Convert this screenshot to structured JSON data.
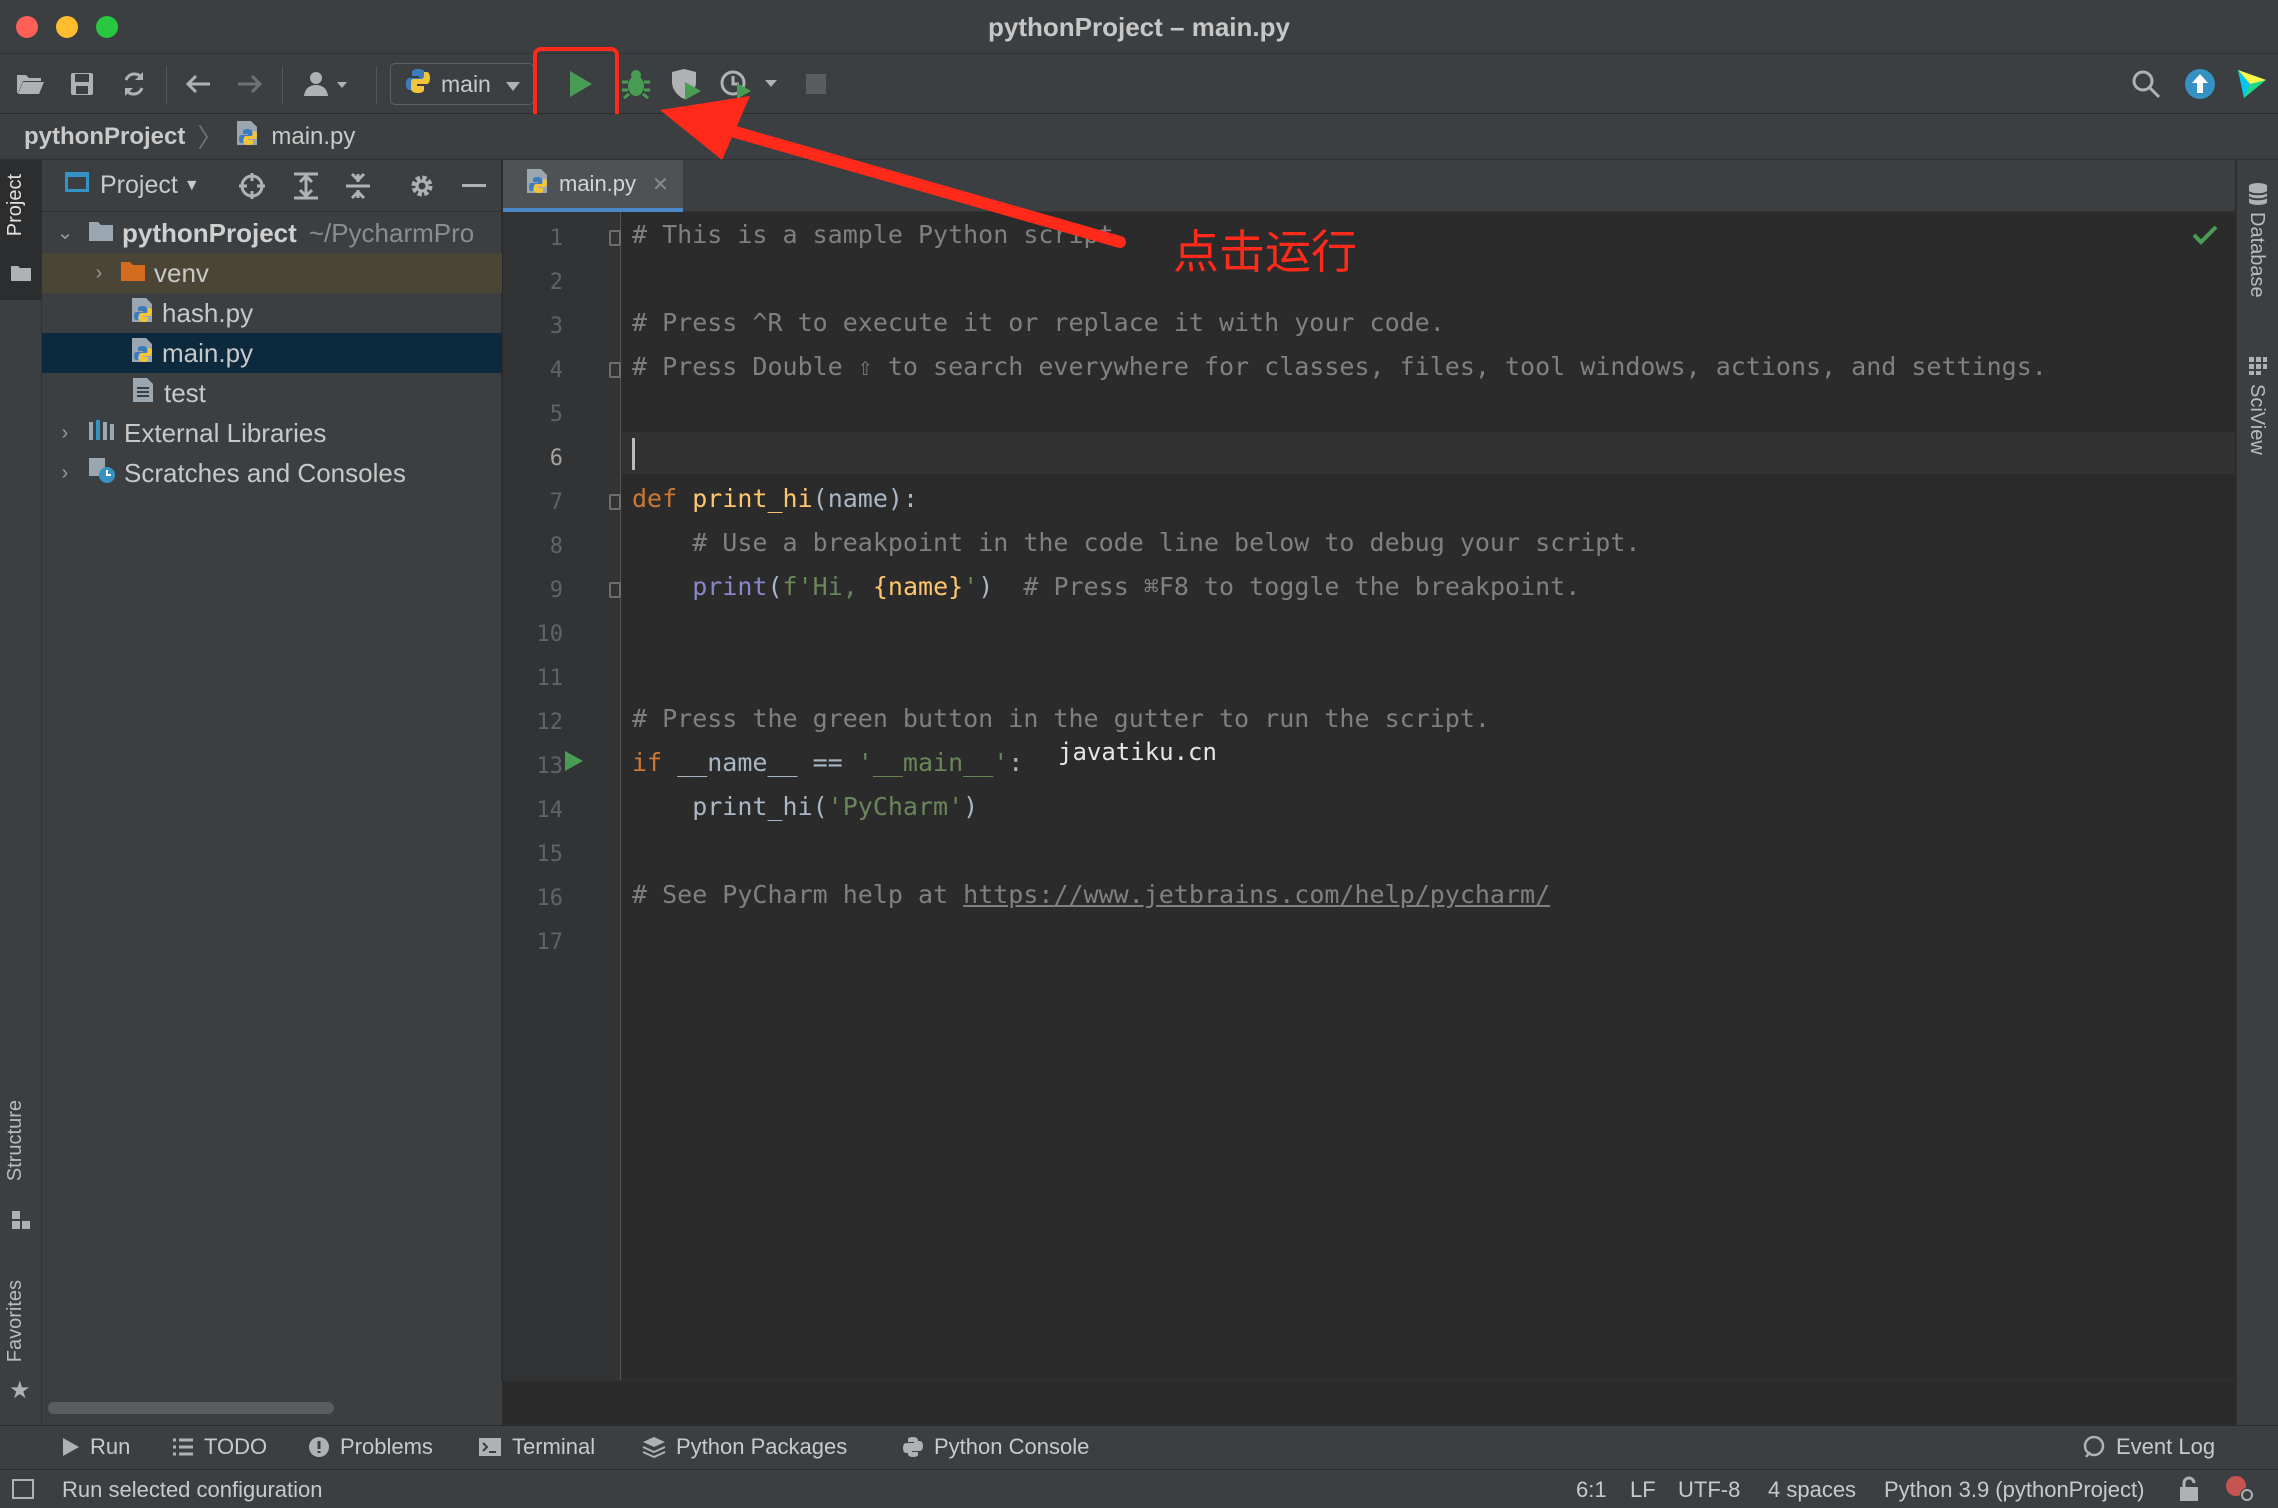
{
  "window": {
    "title": "pythonProject – main.py"
  },
  "toolbar": {
    "run_config": "main"
  },
  "breadcrumb": {
    "project": "pythonProject",
    "file": "main.py"
  },
  "project_panel": {
    "header": "Project",
    "tree": [
      {
        "name": "pythonProject",
        "suffix": "~/PycharmPro"
      },
      {
        "name": "venv"
      },
      {
        "name": "hash.py"
      },
      {
        "name": "main.py"
      },
      {
        "name": "test"
      },
      {
        "name": "External Libraries"
      },
      {
        "name": "Scratches and Consoles"
      }
    ]
  },
  "editor": {
    "tab": "main.py",
    "line_numbers": [
      "1",
      "2",
      "3",
      "4",
      "5",
      "6",
      "7",
      "8",
      "9",
      "10",
      "11",
      "12",
      "13",
      "14",
      "15",
      "16",
      "17"
    ],
    "lines": {
      "l1": "# This is a sample Python script.",
      "l3": "# Press ^R to execute it or replace it with your code.",
      "l4": "# Press Double ⇧ to search everywhere for classes, files, tool windows, actions, and settings.",
      "l7_kw": "def ",
      "l7_fn": "print_hi",
      "l7_rest": "(name):",
      "l8": "    # Use a breakpoint in the code line below to debug your script.",
      "l9_pre": "    ",
      "l9_bi": "print",
      "l9_open": "(",
      "l9_str1": "f'Hi, ",
      "l9_var": "{name}",
      "l9_str2": "'",
      "l9_close": ")  ",
      "l9_cm": "# Press ⌘F8 to toggle the breakpoint.",
      "l12": "# Press the green button in the gutter to run the script.",
      "l13_kw": "if ",
      "l13_mid": "__name__ == ",
      "l13_str": "'__main__'",
      "l13_end": ":",
      "l14_pre": "    print_hi(",
      "l14_str": "'PyCharm'",
      "l14_end": ")",
      "l16_cm": "# See PyCharm help at ",
      "l16_link": "https://www.jetbrains.com/help/pycharm/"
    }
  },
  "annotation": {
    "text": "点击运行",
    "watermark": "javatiku.cn"
  },
  "left_strip": {
    "project": "Project",
    "structure": "Structure",
    "favorites": "Favorites"
  },
  "right_strip": {
    "database": "Database",
    "sciview": "SciView"
  },
  "tool_windows": {
    "run": "Run",
    "todo": "TODO",
    "problems": "Problems",
    "terminal": "Terminal",
    "python_packages": "Python Packages",
    "python_console": "Python Console",
    "event_log": "Event Log"
  },
  "status": {
    "message": "Run selected configuration",
    "position": "6:1",
    "line_sep": "LF",
    "encoding": "UTF-8",
    "indent": "4 spaces",
    "interpreter": "Python 3.9 (pythonProject)"
  },
  "colors": {
    "accent": "#4a88c7",
    "run_green": "#499c54",
    "highlight_red": "#ff2a1a",
    "selection": "#0d293e"
  }
}
